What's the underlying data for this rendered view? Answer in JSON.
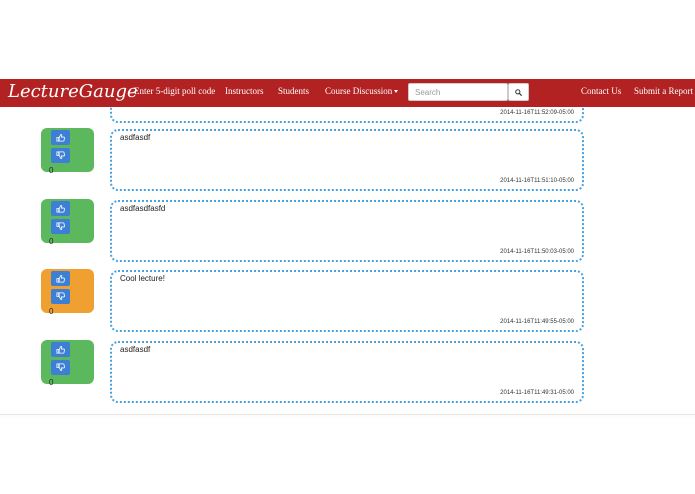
{
  "navbar": {
    "brand": "LectureGauge",
    "poll_code": "Enter 5-digit poll code",
    "instructors": "Instructors",
    "students": "Students",
    "course_discussion": "Course Discussion",
    "search_placeholder": "Search",
    "contact": "Contact Us",
    "submit_report": "Submit a Report"
  },
  "colors": {
    "navbar": "#b22222",
    "vote_green": "#5cb85c",
    "vote_orange": "#f0a030",
    "vote_button": "#3d7fd4",
    "comment_border": "#4aa3df"
  },
  "partial_comment": {
    "timestamp": "2014-11-16T11:52:09-05:00"
  },
  "comments": [
    {
      "text": "asdfasdf",
      "timestamp": "2014-11-16T11:51:10-05:00",
      "votes": "0",
      "color": "green"
    },
    {
      "text": "asdfasdfasfd",
      "timestamp": "2014-11-16T11:50:03-05:00",
      "votes": "0",
      "color": "green"
    },
    {
      "text": "Cool lecture!",
      "timestamp": "2014-11-16T11:49:55-05:00",
      "votes": "0",
      "color": "orange"
    },
    {
      "text": "asdfasdf",
      "timestamp": "2014-11-16T11:49:31-05:00",
      "votes": "0",
      "color": "green"
    }
  ]
}
